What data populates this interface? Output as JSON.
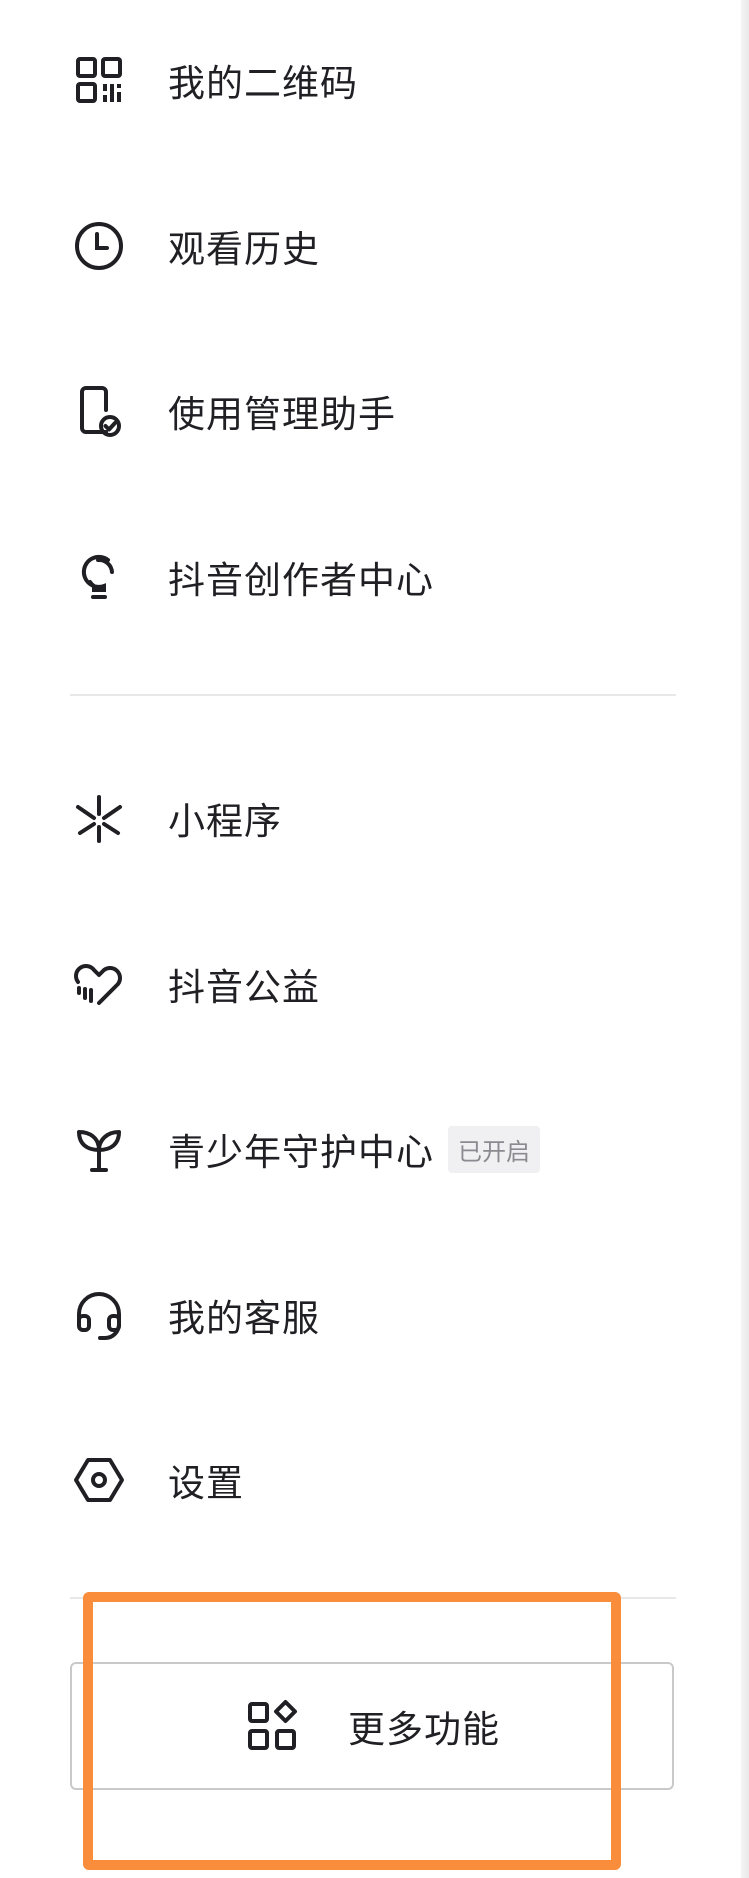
{
  "menu": {
    "items": [
      {
        "label": "我的二维码",
        "icon": "qr-code-icon"
      },
      {
        "label": "观看历史",
        "icon": "clock-icon"
      },
      {
        "label": "使用管理助手",
        "icon": "phone-check-icon"
      },
      {
        "label": "抖音创作者中心",
        "icon": "lightbulb-icon"
      },
      {
        "label": "小程序",
        "icon": "mini-program-icon"
      },
      {
        "label": "抖音公益",
        "icon": "heart-icon"
      },
      {
        "label": "青少年守护中心",
        "icon": "sprout-icon",
        "badge": "已开启"
      },
      {
        "label": "我的客服",
        "icon": "headset-icon"
      },
      {
        "label": "设置",
        "icon": "hexagon-settings-icon"
      }
    ]
  },
  "more": {
    "label": "更多功能",
    "icon": "grid-apps-icon"
  },
  "colors": {
    "highlight": "#f98d3c",
    "text": "#1f1f24",
    "divider": "#e8e8ea"
  }
}
